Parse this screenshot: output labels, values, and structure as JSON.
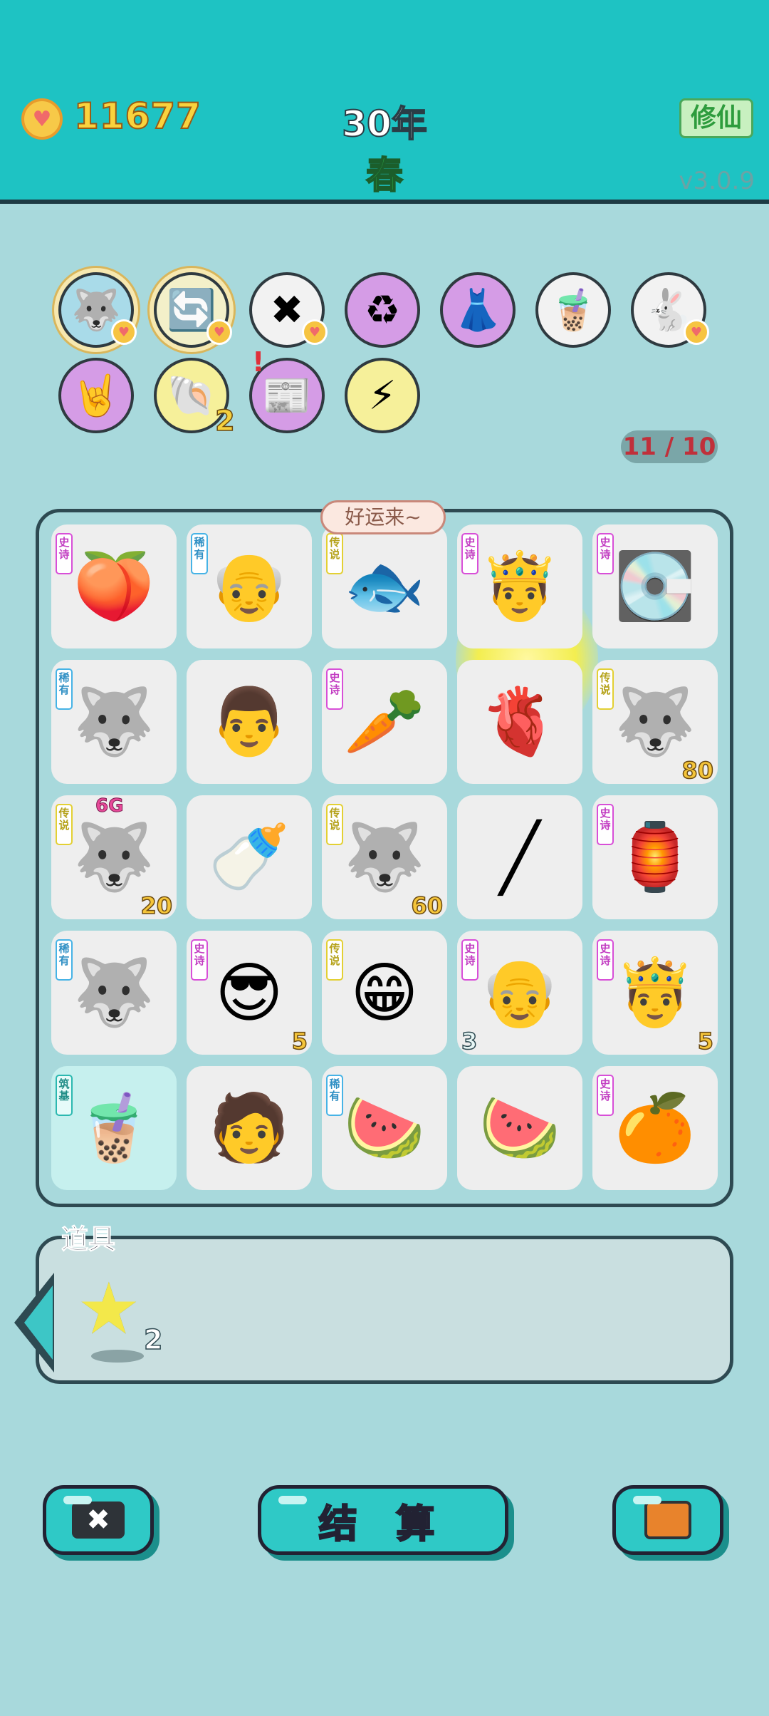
{
  "header": {
    "coins": "11677",
    "year": "30年",
    "season": "春",
    "mode_button": "修仙",
    "version": "v3.0.9"
  },
  "relics": [
    {
      "icon": "husky-dog-icon",
      "glyph": "🐺",
      "bg": "#a9dbe9",
      "gold": true,
      "heart": true
    },
    {
      "icon": "refresh-icon",
      "glyph": "🔄",
      "bg": "#f3f0c9",
      "gold": true,
      "heart": true
    },
    {
      "icon": "delete-tag-icon",
      "glyph": "✖",
      "bg": "#f2f2f2",
      "gold": false,
      "heart": true
    },
    {
      "icon": "recycle-icon",
      "glyph": "♻",
      "bg": "#d59ce6",
      "gold": false,
      "heart": false
    },
    {
      "icon": "skirt-icon",
      "glyph": "👗",
      "bg": "#d59ce6",
      "gold": false,
      "heart": false
    },
    {
      "icon": "milk-tea-icon",
      "glyph": "🧋",
      "bg": "#f2f2f2",
      "gold": false,
      "heart": false
    },
    {
      "icon": "rabbit-icon",
      "glyph": "🐇",
      "bg": "#f2f2f2",
      "gold": false,
      "heart": true
    },
    {
      "icon": "rock-hand-icon",
      "glyph": "🤘",
      "bg": "#d59ce6",
      "gold": false,
      "heart": false
    },
    {
      "icon": "shell-icon",
      "glyph": "🐚",
      "bg": "#f6f09a",
      "gold": false,
      "heart": false,
      "count": "2"
    },
    {
      "icon": "time-magazine-icon",
      "glyph": "📰",
      "bg": "#d59ce6",
      "gold": false,
      "heart": false,
      "alert": "!"
    },
    {
      "icon": "lightning-icon",
      "glyph": "⚡",
      "bg": "#f6f09a",
      "gold": false,
      "heart": false
    }
  ],
  "slot_count": "11 / 10",
  "bubble": "好运来~",
  "board": [
    {
      "tag": "史诗",
      "tagType": "epic",
      "icon": "peach-icon",
      "glyph": "🍑"
    },
    {
      "tag": "稀有",
      "tagType": "rare",
      "icon": "bald-man-icon",
      "glyph": "👴"
    },
    {
      "tag": "传说",
      "tagType": "legend",
      "icon": "koi-fish-icon",
      "glyph": "🐟"
    },
    {
      "tag": "史诗",
      "tagType": "epic",
      "icon": "crowned-old-man-icon",
      "glyph": "🤴"
    },
    {
      "tag": "史诗",
      "tagType": "epic",
      "icon": "graphics-card-icon",
      "glyph": "💽"
    },
    {
      "tag": "稀有",
      "tagType": "rare",
      "icon": "husky-dog-icon",
      "glyph": "🐺"
    },
    {
      "tag": "",
      "tagType": "",
      "icon": "glasses-man-icon",
      "glyph": "👨"
    },
    {
      "tag": "史诗",
      "tagType": "epic",
      "icon": "carrot-icon",
      "glyph": "🥕"
    },
    {
      "tag": "",
      "tagType": "",
      "icon": "liver-icon",
      "glyph": "🫀"
    },
    {
      "tag": "传说",
      "tagType": "legend",
      "icon": "crowned-husky-icon",
      "glyph": "🐺",
      "count": "80"
    },
    {
      "tag": "传说",
      "tagType": "legend",
      "icon": "crowned-husky-icon",
      "glyph": "🐺",
      "count": "20",
      "badge": "6G"
    },
    {
      "tag": "",
      "tagType": "",
      "icon": "milk-bottle-icon",
      "glyph": "🍼"
    },
    {
      "tag": "传说",
      "tagType": "legend",
      "icon": "crowned-husky-icon",
      "glyph": "🐺",
      "count": "60"
    },
    {
      "tag": "",
      "tagType": "",
      "icon": "straw-icon",
      "glyph": "╱"
    },
    {
      "tag": "史诗",
      "tagType": "epic",
      "icon": "rabbit-house-icon",
      "glyph": "🏮"
    },
    {
      "tag": "稀有",
      "tagType": "rare",
      "icon": "husky-dog-icon",
      "glyph": "🐺"
    },
    {
      "tag": "史诗",
      "tagType": "epic",
      "icon": "sunglasses-man-icon",
      "glyph": "😎",
      "count": "5"
    },
    {
      "tag": "传说",
      "tagType": "legend",
      "icon": "grinning-bald-man-icon",
      "glyph": "😁"
    },
    {
      "tag": "史诗",
      "tagType": "epic",
      "icon": "old-man-icon",
      "glyph": "👴",
      "count": "3",
      "countLeft": true
    },
    {
      "tag": "史诗",
      "tagType": "epic",
      "icon": "crowned-old-man-icon",
      "glyph": "🤴",
      "count": "5"
    },
    {
      "tag": "筑基",
      "tagType": "base",
      "icon": "milk-tea-icon",
      "glyph": "🧋",
      "teal": true
    },
    {
      "tag": "",
      "tagType": "",
      "icon": "man-face-icon",
      "glyph": "🧑"
    },
    {
      "tag": "稀有",
      "tagType": "rare",
      "icon": "watermelon-slice-icon",
      "glyph": "🍉"
    },
    {
      "tag": "",
      "tagType": "",
      "icon": "watermelon-wedge-icon",
      "glyph": "🍉"
    },
    {
      "tag": "史诗",
      "tagType": "epic",
      "icon": "orange-icon",
      "glyph": "🍊"
    }
  ],
  "items": {
    "title": "道具",
    "list": [
      {
        "icon": "star-icon",
        "glyph": "★",
        "count": "2"
      }
    ]
  },
  "actions": {
    "settle": "结 算"
  }
}
